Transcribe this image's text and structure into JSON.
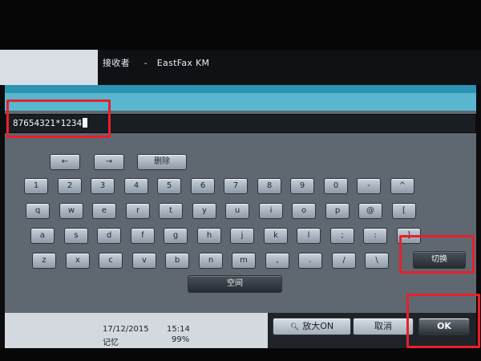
{
  "header": {
    "recipient_label": "接收者",
    "dash": "-",
    "recipient_value": "EastFax KM"
  },
  "input": {
    "value": "87654321*1234"
  },
  "keys": {
    "arrow_left": "←",
    "arrow_right": "→",
    "delete": "删除",
    "row1": [
      "1",
      "2",
      "3",
      "4",
      "5",
      "6",
      "7",
      "8",
      "9",
      "0",
      "-",
      "^"
    ],
    "row2": [
      "q",
      "w",
      "e",
      "r",
      "t",
      "y",
      "u",
      "i",
      "o",
      "p",
      "@",
      "["
    ],
    "row3": [
      "a",
      "s",
      "d",
      "f",
      "g",
      "h",
      "j",
      "k",
      "l",
      ";",
      ":",
      "]"
    ],
    "row4": [
      "z",
      "x",
      "c",
      "v",
      "b",
      "n",
      "m",
      ",",
      ".",
      "/",
      "\\"
    ],
    "switch": "切换",
    "space": "空间"
  },
  "footer": {
    "date": "17/12/2015",
    "time": "15:14",
    "memory_label": "记忆",
    "memory_value": "99%",
    "zoom_label": "放大ON",
    "cancel_label": "取消",
    "ok_label": "OK"
  },
  "colors": {
    "highlight": "#e8202a",
    "title_bar": "#58b6cf",
    "panel": "#5f6771"
  }
}
